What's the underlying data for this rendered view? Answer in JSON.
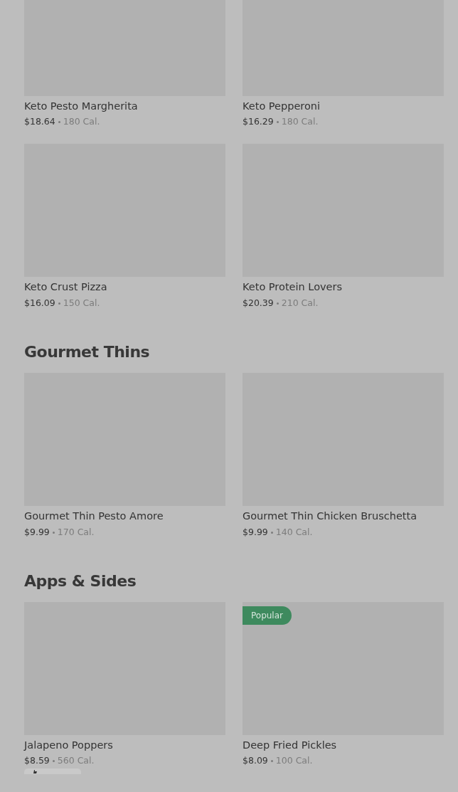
{
  "sections": [
    {
      "items": [
        {
          "name": "Keto Pesto Margherita",
          "price": "$18.64",
          "calories": "180 Cal."
        },
        {
          "name": "Keto Pepperoni",
          "price": "$16.29",
          "calories": "180 Cal."
        },
        {
          "name": "Keto Crust Pizza",
          "price": "$16.09",
          "calories": "150 Cal."
        },
        {
          "name": "Keto Protein Lovers",
          "price": "$20.39",
          "calories": "210 Cal."
        }
      ]
    },
    {
      "title": "Gourmet Thins",
      "items": [
        {
          "name": "Gourmet Thin Pesto Amore",
          "price": "$9.99",
          "calories": "170 Cal."
        },
        {
          "name": "Gourmet Thin Chicken Bruschetta",
          "price": "$9.99",
          "calories": "140 Cal."
        }
      ]
    },
    {
      "title": "Apps & Sides",
      "items": [
        {
          "name": "Jalapeno Poppers",
          "price": "$8.59",
          "calories": "560 Cal.",
          "rated": true
        },
        {
          "name": "Deep Fried Pickles",
          "price": "$8.09",
          "calories": "100 Cal.",
          "badge": "Popular"
        }
      ]
    }
  ]
}
